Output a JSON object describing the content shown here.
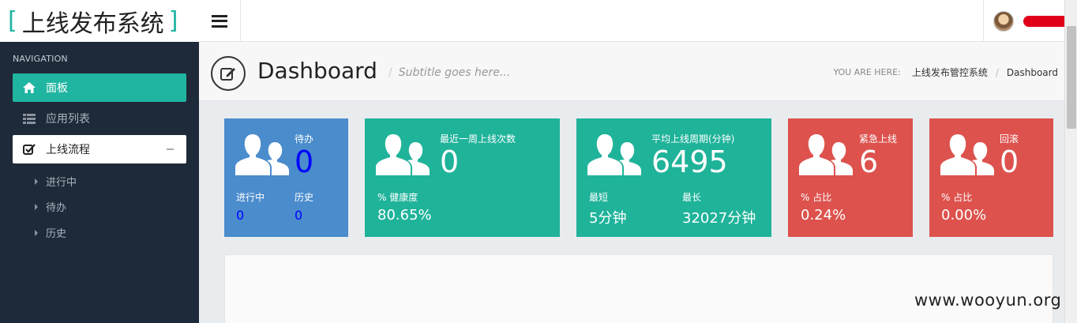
{
  "brand": {
    "bracket_open": "[",
    "title": "上线发布系统",
    "bracket_close": "]"
  },
  "topbar": {
    "username": "redacted"
  },
  "sidebar": {
    "heading": "NAVIGATION",
    "items": [
      {
        "label": "面板",
        "icon": "home-icon",
        "active": true
      },
      {
        "label": "应用列表",
        "icon": "list-icon"
      },
      {
        "label": "上线流程",
        "icon": "check-square-icon",
        "expanded": true
      }
    ],
    "subitems": [
      {
        "label": "进行中"
      },
      {
        "label": "待办"
      },
      {
        "label": "历史"
      }
    ]
  },
  "header": {
    "title": "Dashboard",
    "subtitle": "Subtitle goes here...",
    "breadcrumb_label": "YOU ARE HERE:",
    "breadcrumb": [
      "上线发布管控系统",
      "Dashboard"
    ]
  },
  "stats": {
    "todo": {
      "label": "待办",
      "value": "0",
      "in_progress_label": "进行中",
      "in_progress_value": "0",
      "history_label": "历史",
      "history_value": "0",
      "color": "#4a8ccc"
    },
    "weekly": {
      "label": "最近一周上线次数",
      "value": "0",
      "foot_label": "% 健康度",
      "foot_value": "80.65%",
      "color": "#1fb39a"
    },
    "cycle": {
      "label": "平均上线周期(分钟)",
      "value": "6495",
      "min_label": "最短",
      "min_value": "5分钟",
      "max_label": "最长",
      "max_value": "32027分钟",
      "color": "#1fb39a"
    },
    "urgent": {
      "label": "紧急上线",
      "value": "6",
      "foot_label": "% 占比",
      "foot_value": "0.24%",
      "color": "#dd524d"
    },
    "rollback": {
      "label": "回滚",
      "value": "0",
      "foot_label": "% 占比",
      "foot_value": "0.00%",
      "color": "#dd524d"
    }
  },
  "watermark": "www.wooyun.org"
}
